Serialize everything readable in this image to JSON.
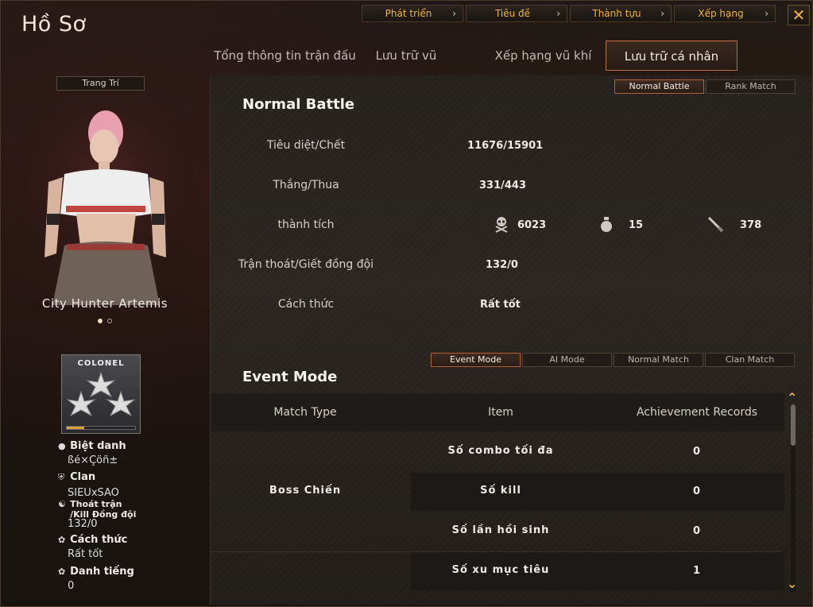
{
  "title": "Hồ Sơ",
  "top_nav": [
    {
      "label": "Phát triển"
    },
    {
      "label": "Tiêu đề"
    },
    {
      "label": "Thành tựu"
    },
    {
      "label": "Xếp hạng"
    }
  ],
  "close_label": "✕",
  "tabs": [
    {
      "label": "Tổng thông tin trận đấu",
      "active": false
    },
    {
      "label": "Lưu trữ vũ khí",
      "active": false
    },
    {
      "label": "Xếp hạng vũ khí",
      "active": false
    },
    {
      "label": "Lưu trữ cá nhân",
      "active": true
    }
  ],
  "left": {
    "decorate_button": "Trang Trí",
    "character_name": "City Hunter Artemis",
    "rank_label": "COLONEL",
    "rank_progress": 0.25,
    "info": [
      {
        "icon": "person-icon",
        "key": "Biệt danh",
        "value": "ßé×Çöñ±"
      },
      {
        "icon": "clan-icon",
        "key": "Clan",
        "value": "SIEUxSAO"
      },
      {
        "icon": "running-man-icon",
        "key": "Thoát trận\n/Kill Đồng đội",
        "value": "132/0"
      },
      {
        "icon": "flower-icon",
        "key": "Cách thức",
        "value": "Rất tốt"
      },
      {
        "icon": "flower-icon",
        "key": "Danh tiếng",
        "value": "0"
      }
    ]
  },
  "normal": {
    "mode_buttons": [
      {
        "label": "Normal Battle",
        "active": true
      },
      {
        "label": "Rank Match",
        "active": false
      }
    ],
    "title": "Normal Battle",
    "stats": [
      {
        "label": "Tiêu diệt/Chết",
        "value": "11676/15901"
      },
      {
        "label": "Thắng/Thua",
        "value": "331/443"
      },
      {
        "label": "thành tích",
        "value": ""
      },
      {
        "label": "Trận thoát/Giết đồng đội",
        "value": "132/0"
      },
      {
        "label": "Cách thức",
        "value": "Rất tốt"
      }
    ],
    "achievements": [
      {
        "icon": "skull-crossbones-icon",
        "value": "6023"
      },
      {
        "icon": "grenade-icon",
        "value": "15"
      },
      {
        "icon": "knife-icon",
        "value": "378"
      }
    ]
  },
  "event": {
    "title": "Event Mode",
    "mode_buttons": [
      {
        "label": "Event Mode",
        "active": true
      },
      {
        "label": "AI Mode",
        "active": false
      },
      {
        "label": "Normal Match",
        "active": false
      },
      {
        "label": "Clan Match",
        "active": false
      }
    ],
    "headers": [
      "Match Type",
      "Item",
      "Achievement Records"
    ],
    "match_type": "Boss Chiến",
    "rows": [
      {
        "item": "Số combo tối đa",
        "value": "0"
      },
      {
        "item": "Số kill",
        "value": "0"
      },
      {
        "item": "Số lần hồi sinh",
        "value": "0"
      },
      {
        "item": "Số xu mục tiêu",
        "value": "1"
      }
    ]
  },
  "colors": {
    "accent": "#f2b33c",
    "active_border": "#c76a3c"
  }
}
